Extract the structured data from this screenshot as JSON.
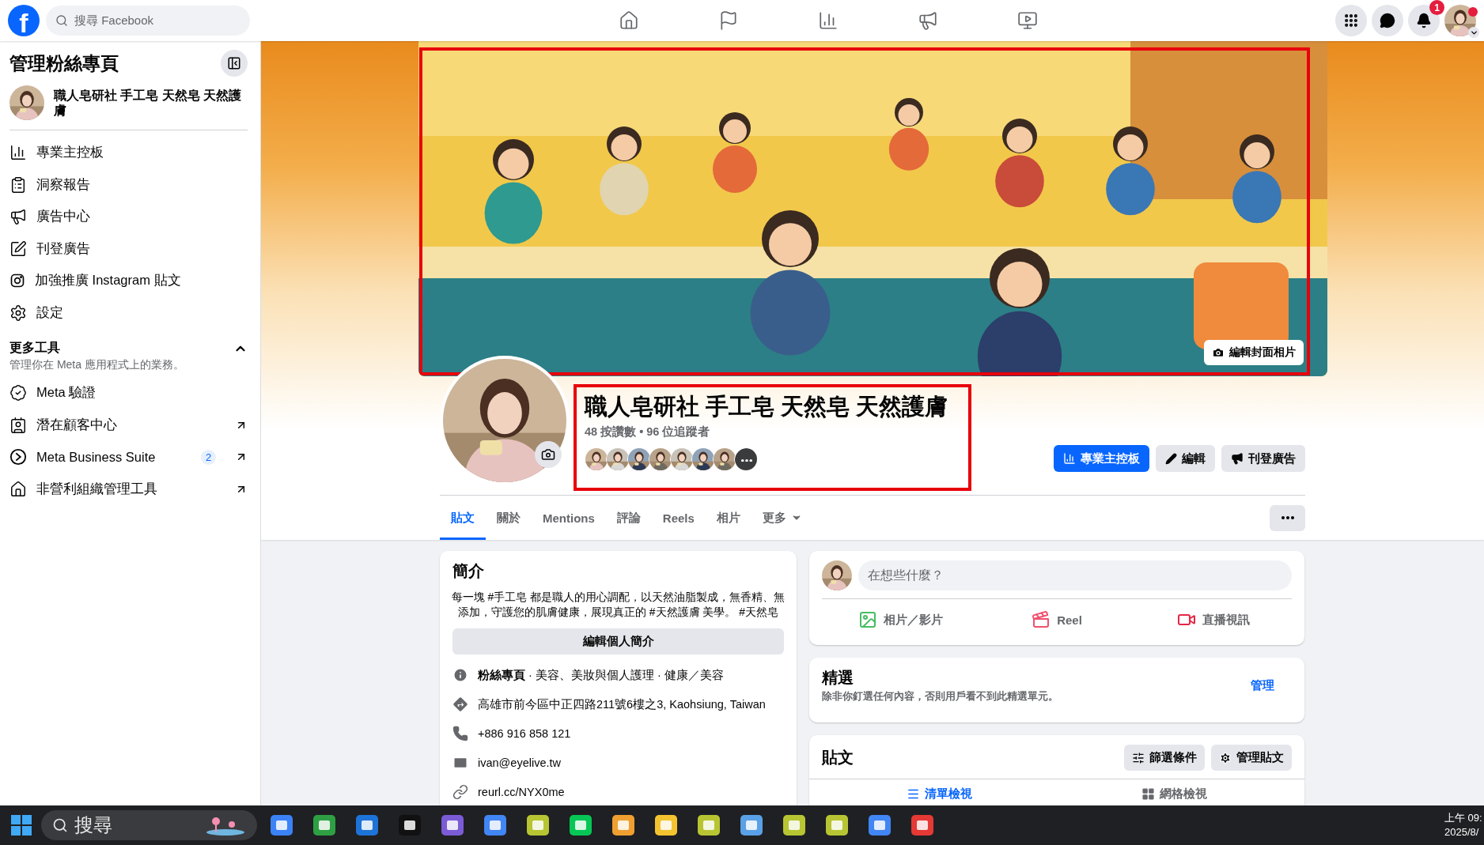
{
  "topbar": {
    "logo": "f",
    "search_placeholder": "搜尋 Facebook",
    "notification_count": "1"
  },
  "sidebar": {
    "title": "管理粉絲專頁",
    "page_name": "職人皂研社 手工皂 天然皂 天然護膚",
    "items": [
      {
        "kind": "dashboard",
        "label": "專業主控板"
      },
      {
        "kind": "insights",
        "label": "洞察報告"
      },
      {
        "kind": "ads",
        "label": "廣告中心"
      },
      {
        "kind": "post",
        "label": "刊登廣告"
      },
      {
        "kind": "instagram",
        "label": "加強推廣 Instagram 貼文"
      },
      {
        "kind": "settings",
        "label": "設定"
      }
    ],
    "section": {
      "title": "更多工具",
      "subtitle": "管理你在 Meta 應用程式上的業務。",
      "expanded": true
    },
    "tools": [
      {
        "kind": "verify",
        "label": "Meta 驗證",
        "external": false
      },
      {
        "kind": "leads",
        "label": "潛在顧客中心",
        "external": true
      },
      {
        "kind": "suite",
        "label": "Meta Business Suite",
        "badge": "2",
        "external": true
      },
      {
        "kind": "nonprofit",
        "label": "非營利組織管理工具",
        "external": true
      }
    ]
  },
  "cover": {
    "edit_button": "編輯封面相片"
  },
  "profile": {
    "name": "職人皂研社 手工皂 天然皂 天然護膚",
    "stats": "48 按讚數 • 96 位追蹤者",
    "buttons": [
      {
        "kind": "primary",
        "label": "專業主控板"
      },
      {
        "kind": "secondary",
        "label": "編輯"
      },
      {
        "kind": "secondary",
        "label": "刊登廣告"
      }
    ]
  },
  "tabs": [
    {
      "label": "貼文",
      "selected": true,
      "dropdown": false
    },
    {
      "label": "關於",
      "selected": false,
      "dropdown": false
    },
    {
      "label": "Mentions",
      "selected": false,
      "dropdown": false
    },
    {
      "label": "評論",
      "selected": false,
      "dropdown": false
    },
    {
      "label": "Reels",
      "selected": false,
      "dropdown": false
    },
    {
      "label": "相片",
      "selected": false,
      "dropdown": false
    },
    {
      "label": "更多",
      "selected": false,
      "dropdown": true
    }
  ],
  "intro": {
    "title": "簡介",
    "bio": "每一塊 #手工皂 都是職人的用心調配，以天然油脂製成，無香精、無添加，守護您的肌膚健康，展現真正的 #天然護膚 美學。 #天然皂",
    "edit_button": "編輯個人簡介",
    "details": [
      {
        "kind": "category",
        "text": "**粉絲專頁** · 美容、美妝與個人護理 · 健康／美容"
      },
      {
        "kind": "address",
        "text": "高雄市前今區中正四路211號6樓之3, Kaohsiung, Taiwan"
      },
      {
        "kind": "phone",
        "text": "+886 916 858 121"
      },
      {
        "kind": "email",
        "text": "ivan@eyelive.tw"
      },
      {
        "kind": "link",
        "text": "reurl.cc/NYX0me"
      }
    ]
  },
  "composer": {
    "placeholder": "在想些什麼？",
    "actions": [
      {
        "label": "相片／影片"
      },
      {
        "kind": "reel",
        "label": "Reel"
      },
      {
        "kind": "live",
        "label": "直播視訊"
      }
    ]
  },
  "featured": {
    "title": "精選",
    "description": "除非你釘選任何內容，否則用戶看不到此精選單元。",
    "action": "管理"
  },
  "posts": {
    "title": "貼文",
    "buttons": [
      {
        "kind": "filter",
        "label": "篩選條件"
      },
      {
        "kind": "manage",
        "label": "管理貼文"
      }
    ],
    "views": [
      {
        "kind": "list",
        "label": "清單檢視",
        "selected": true
      },
      {
        "kind": "grid",
        "label": "網格檢視",
        "selected": false
      }
    ]
  },
  "taskbar": {
    "search": "搜尋",
    "clock": [
      "上午 09:",
      "2025/8/"
    ]
  }
}
